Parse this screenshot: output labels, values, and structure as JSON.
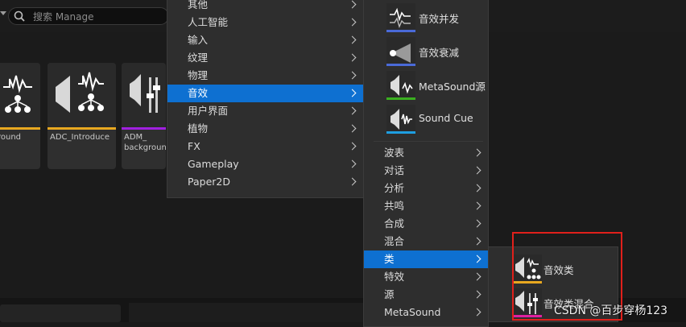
{
  "search": {
    "placeholder": "搜索 Manage"
  },
  "tiles": [
    {
      "label": "round",
      "bar_color": "#e8a820"
    },
    {
      "label": "ADC_Introduce",
      "bar_color": "#e8a820"
    },
    {
      "label": "ADM_\nbackgroun",
      "bar_color": "#a020e0"
    }
  ],
  "category_menu": {
    "items": [
      "其他",
      "人工智能",
      "输入",
      "纹理",
      "物理",
      "音效",
      "用户界面",
      "植物",
      "FX",
      "Gameplay",
      "Paper2D"
    ],
    "selected": "音效"
  },
  "audio_menu": {
    "assets": [
      {
        "label": "音效并发",
        "color": "#4a6ad8"
      },
      {
        "label": "音效衰减",
        "color": "#4a6ad8"
      },
      {
        "label": "MetaSound源",
        "color": "#3ab020"
      },
      {
        "label": "Sound Cue",
        "color": "#1e9ee0"
      }
    ],
    "items": [
      "波表",
      "对话",
      "分析",
      "共鸣",
      "合成",
      "混合",
      "类",
      "特效",
      "源",
      "MetaSound"
    ],
    "selected": "类"
  },
  "class_menu": {
    "items": [
      {
        "label": "音效类",
        "color": "#e8a820"
      },
      {
        "label": "音效类混合",
        "color": "#e020a0"
      }
    ]
  },
  "watermark": "CSDN @百步穿杨123"
}
